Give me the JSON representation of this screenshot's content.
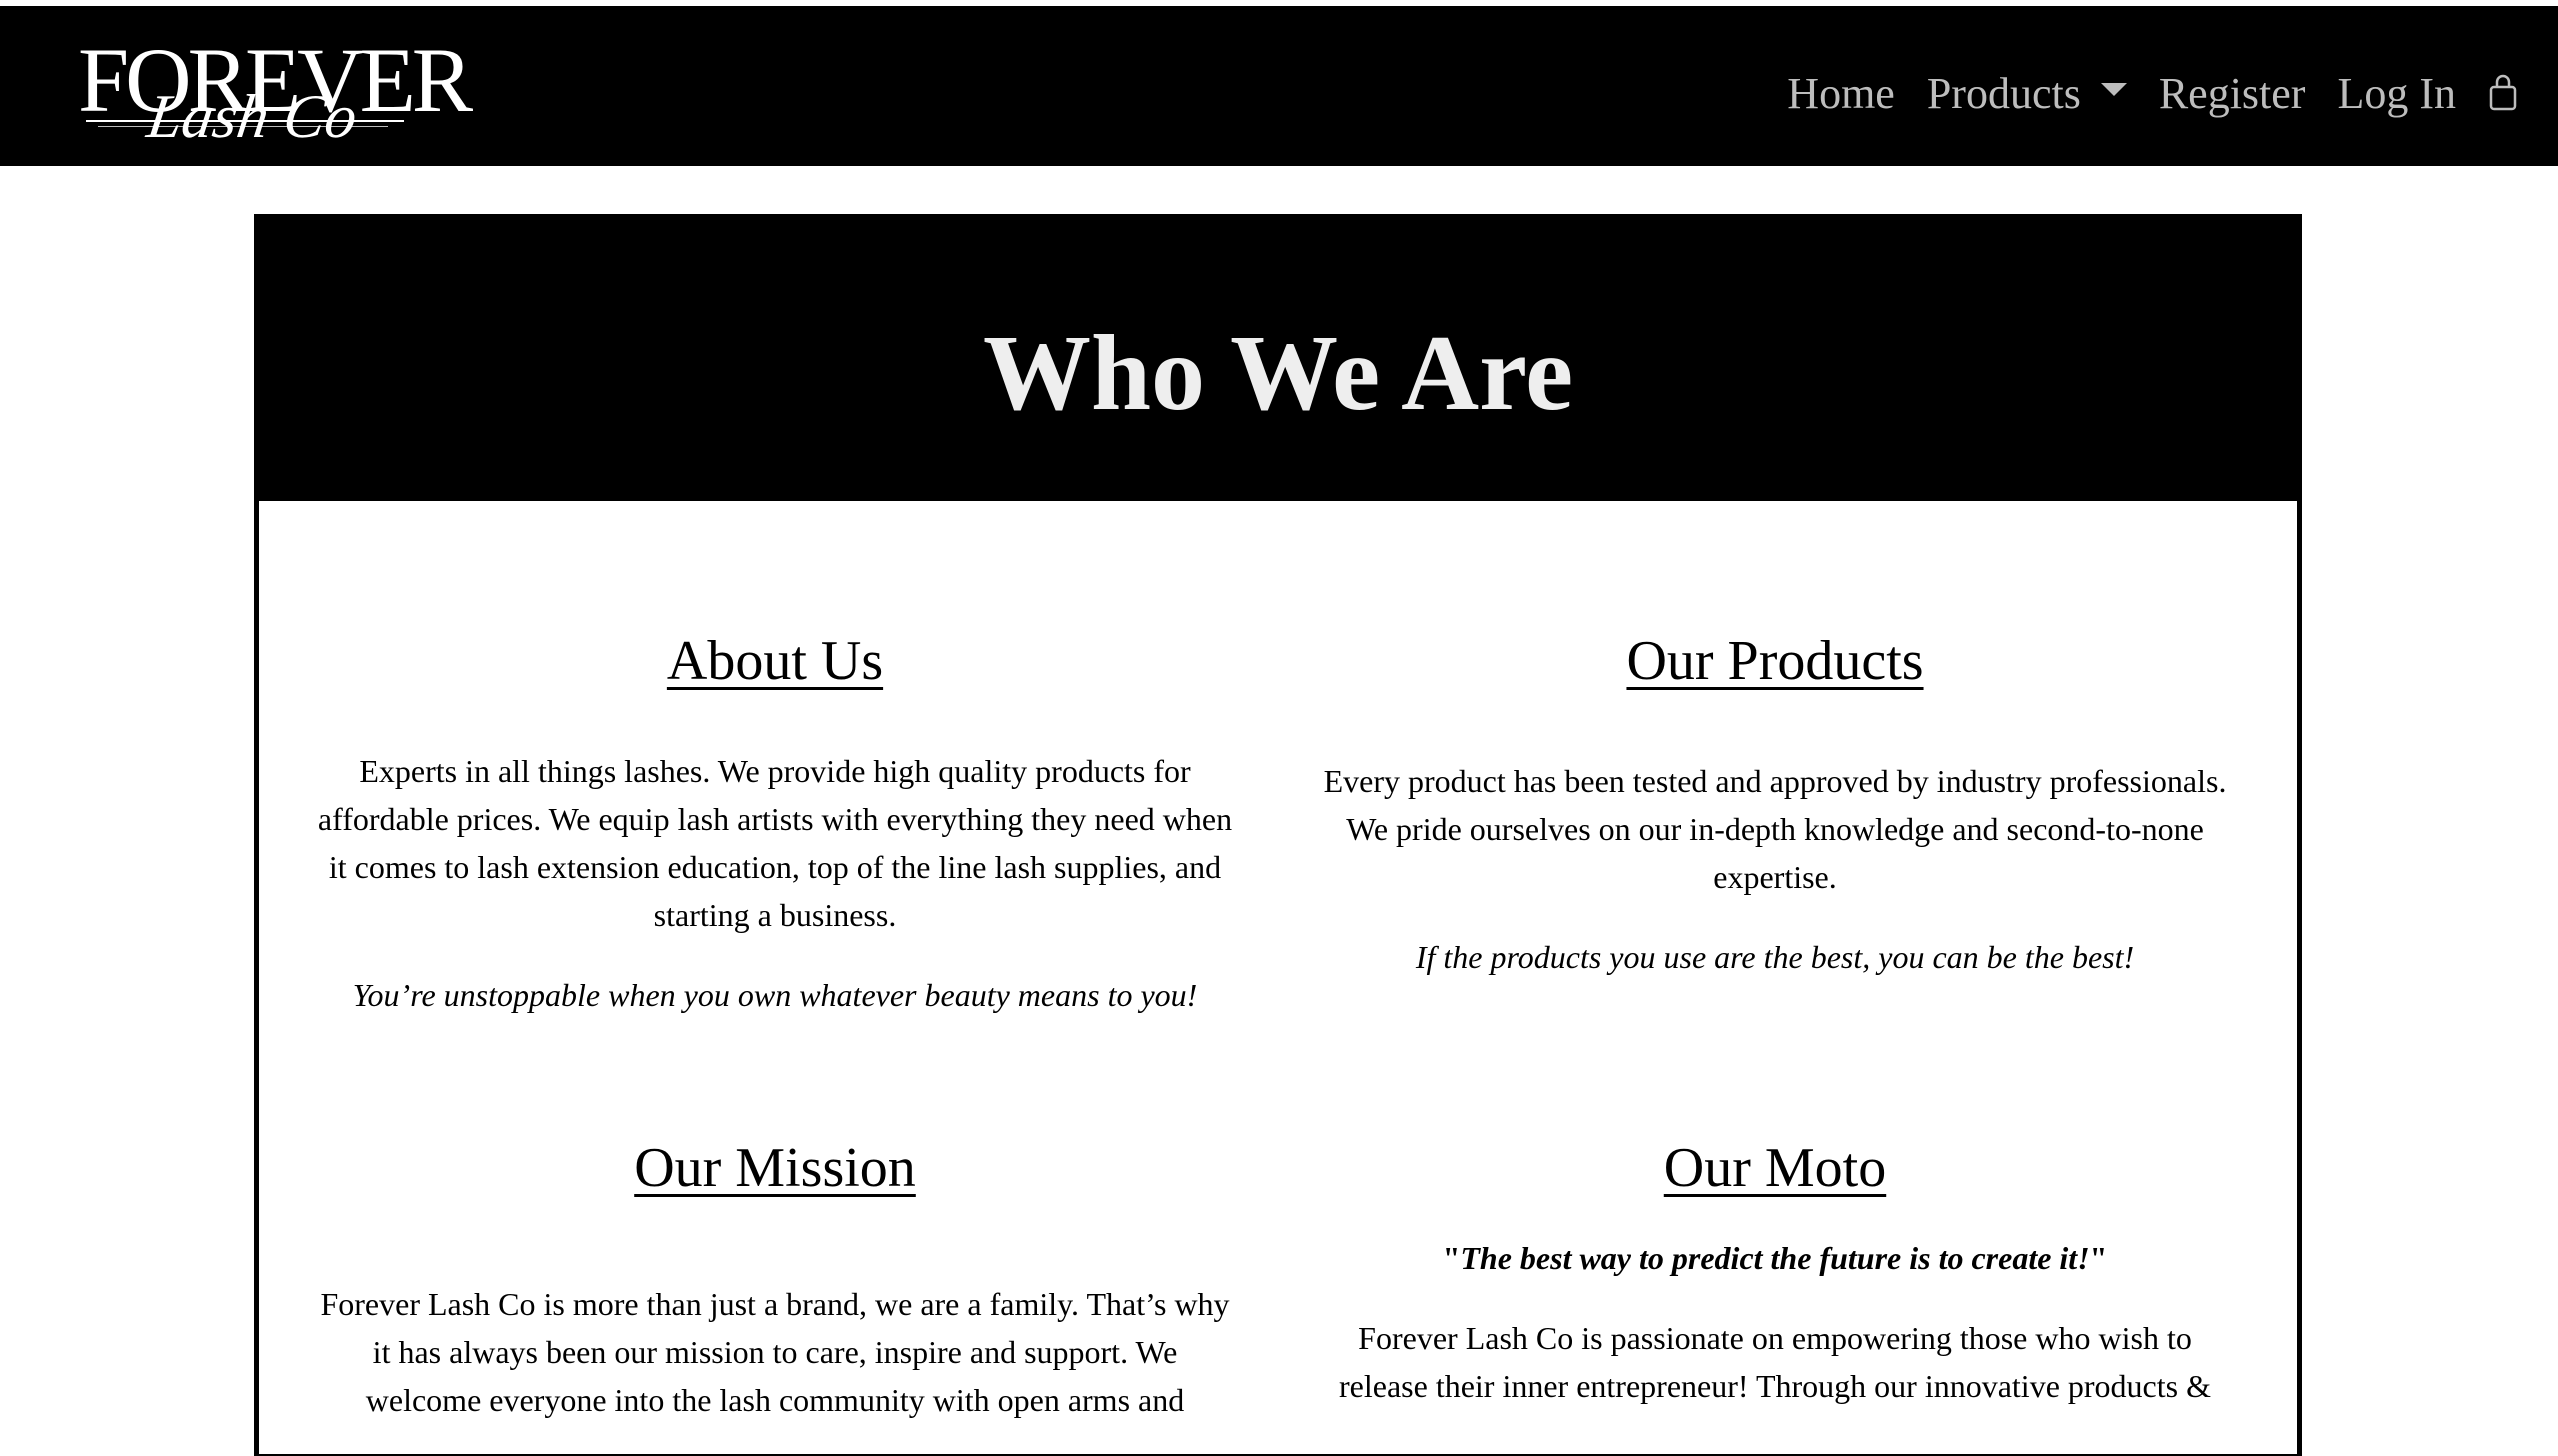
{
  "navbar": {
    "logo_top": "FOREVER",
    "logo_bottom": "Lash Co",
    "links": [
      {
        "label": "Home"
      },
      {
        "label": "Products"
      },
      {
        "label": "Register"
      },
      {
        "label": "Log In"
      }
    ],
    "icons": {
      "dropdown": "caret-down-icon",
      "cart": "shopping-bag-icon"
    },
    "background": "#000000",
    "link_color": "#bdbdbd"
  },
  "hero": {
    "title": "Who We Are"
  },
  "sections": {
    "about": {
      "title": "About Us",
      "body": "Experts in all things lashes. We provide high quality products for affordable prices. We equip lash artists with everything they need when it comes to lash extension education, top of the line lash supplies, and starting a business.",
      "tagline": "You’re unstoppable when you own whatever beauty means to you!"
    },
    "products": {
      "title": "Our Products",
      "body": "Every product has been tested and approved by industry professionals. We pride ourselves on our in-depth knowledge and second-to-none expertise.",
      "tagline": "If the products you use are the best, you can be the best!"
    },
    "mission": {
      "title": "Our Mission",
      "body": "Forever Lash Co is more than just a brand, we are a family. That’s why it has always been our mission to care, inspire and support. We welcome everyone into the lash community with open arms and"
    },
    "moto": {
      "title": "Our Moto",
      "quote_open": "\"",
      "quote": "The best way to predict the future is to create it!",
      "quote_close": "\"",
      "body": "Forever Lash Co is passionate on empowering those who wish to release their inner entrepreneur! Through our innovative products &"
    }
  }
}
